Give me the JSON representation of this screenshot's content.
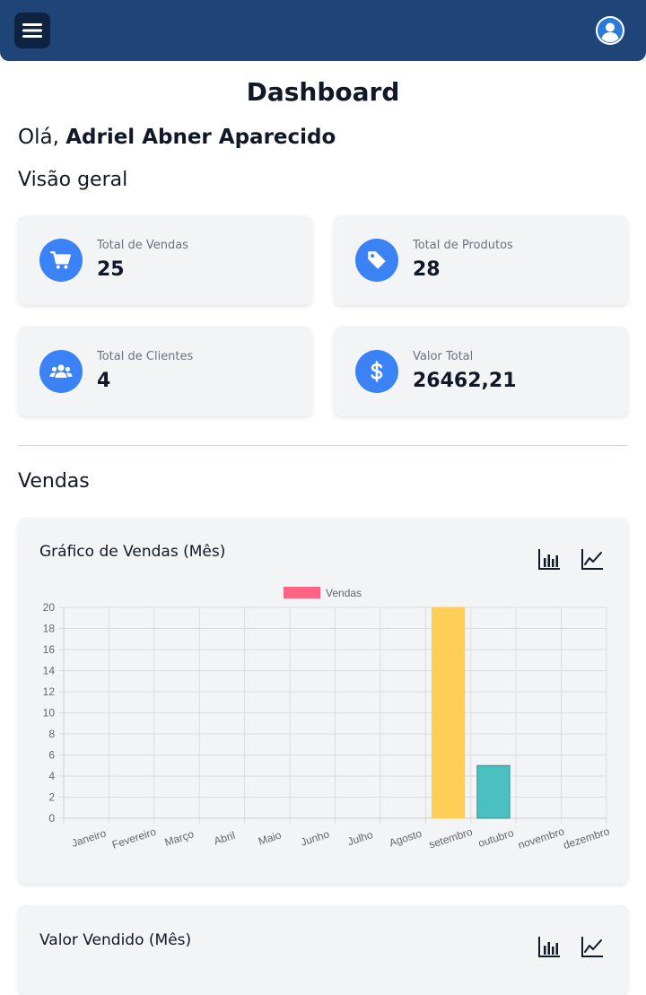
{
  "header": {
    "menu_icon": "hamburger-menu-icon",
    "avatar_icon": "user-avatar-icon"
  },
  "page": {
    "title": "Dashboard",
    "greeting_prefix": "Olá,",
    "user_name": "Adriel Abner Aparecido"
  },
  "overview": {
    "heading": "Visão geral",
    "cards": [
      {
        "label": "Total de Vendas",
        "value": "25",
        "icon": "cart-icon"
      },
      {
        "label": "Total de Produtos",
        "value": "28",
        "icon": "tag-icon"
      },
      {
        "label": "Total de Clientes",
        "value": "4",
        "icon": "users-icon"
      },
      {
        "label": "Valor Total",
        "value": "26462,21",
        "icon": "dollar-icon"
      }
    ]
  },
  "sales": {
    "heading": "Vendas"
  },
  "chart_panel": {
    "title": "Gráfico de Vendas (Mês)",
    "bar_icon": "bar-chart-icon",
    "line_icon": "line-chart-icon"
  },
  "value_panel": {
    "title": "Valor Vendido (Mês)",
    "bar_icon": "bar-chart-icon",
    "line_icon": "line-chart-icon"
  },
  "colors": {
    "header": "#1e4478",
    "accent": "#3b82f6",
    "legend": "#ff6384"
  },
  "chart_data": {
    "type": "bar",
    "title": "",
    "legend": [
      "Vendas"
    ],
    "categories": [
      "Janeiro",
      "Fevereiro",
      "Março",
      "Abril",
      "Maio",
      "Junho",
      "Julho",
      "Agosto",
      "setembro",
      "outubro",
      "novembro",
      "dezembro"
    ],
    "series": [
      {
        "name": "Vendas",
        "values": [
          0,
          0,
          0,
          0,
          0,
          0,
          0,
          0,
          20,
          5,
          0,
          0
        ]
      }
    ],
    "bar_colors": [
      "#ff6384",
      "#36a2eb",
      "#ffce56",
      "#4bc0c0",
      "#9966ff",
      "#ff9f40",
      "#ff6384",
      "#36a2eb",
      "#ffce56",
      "#4bc0c0",
      "#9966ff",
      "#ff9f40"
    ],
    "bar_borders": [
      "#ff6384",
      "#36a2eb",
      "#ffce56",
      "#4bc0c0",
      "#9966ff",
      "#ff9f40",
      "#ff6384",
      "#36a2eb",
      "#ffce56",
      "#3a8f8f",
      "#9966ff",
      "#ff9f40"
    ],
    "ylim": [
      0,
      20
    ],
    "yticks": [
      0,
      2,
      4,
      6,
      8,
      10,
      12,
      14,
      16,
      18,
      20
    ],
    "grid": true,
    "legend_position": "top"
  }
}
